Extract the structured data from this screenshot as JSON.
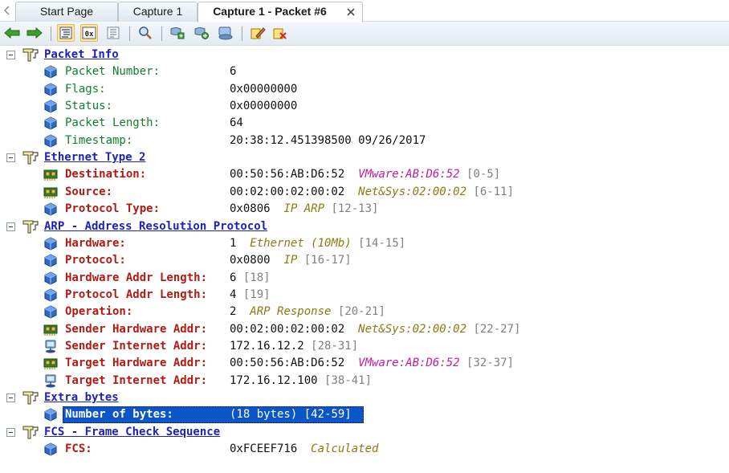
{
  "tabs": [
    {
      "label": "Start Page",
      "active": false
    },
    {
      "label": "Capture 1",
      "active": false
    },
    {
      "label": "Capture 1 - Packet #6",
      "active": true
    }
  ],
  "toolbar": {
    "buttons": [
      "back-arrow-icon",
      "forward-arrow-icon",
      "decode-view-icon",
      "hex-view-icon",
      "text-view-icon",
      "find-icon",
      "add-filter-icon",
      "insert-filter-icon",
      "network-icon",
      "edit-note-icon",
      "clear-note-icon"
    ],
    "hex_label": "0x"
  },
  "colors": {
    "section_title": "#1e22b8",
    "info_label": "#0f7f2e",
    "protocol_label": "#b21a12",
    "description": "#8c7a10",
    "vendor_description": "#c41a9a",
    "byte_range": "#808080",
    "selection": "#0a55c7"
  },
  "sections": [
    {
      "title": "Packet Info",
      "fields": [
        {
          "label": "Packet Number:",
          "style": "info",
          "icon": "cube-icon",
          "value": "6"
        },
        {
          "label": "Flags:",
          "style": "info",
          "icon": "cube-icon",
          "value": "0x00000000"
        },
        {
          "label": "Status:",
          "style": "info",
          "icon": "cube-icon",
          "value": "0x00000000"
        },
        {
          "label": "Packet Length:",
          "style": "info",
          "icon": "cube-icon",
          "value": "64"
        },
        {
          "label": "Timestamp:",
          "style": "info",
          "icon": "cube-icon",
          "value": "20:38:12.451398500 09/26/2017"
        }
      ]
    },
    {
      "title": "Ethernet Type 2",
      "fields": [
        {
          "label": "Destination:",
          "style": "proto",
          "icon": "nic-icon",
          "value": "00:50:56:AB:D6:52",
          "desc": "VMware:AB:D6:52",
          "desc_style": "vendor",
          "range": "[0-5]"
        },
        {
          "label": "Source:",
          "style": "proto",
          "icon": "nic-icon",
          "value": "00:02:00:02:00:02",
          "desc": "Net&Sys:02:00:02",
          "range": "[6-11]"
        },
        {
          "label": "Protocol Type:",
          "style": "proto",
          "icon": "cube-icon",
          "value": "0x0806",
          "desc": "IP ARP",
          "range": "[12-13]"
        }
      ]
    },
    {
      "title": "ARP - Address Resolution Protocol",
      "fields": [
        {
          "label": "Hardware:",
          "style": "proto",
          "icon": "cube-icon",
          "value": "1",
          "desc": "Ethernet (10Mb)",
          "range": "[14-15]"
        },
        {
          "label": "Protocol:",
          "style": "proto",
          "icon": "cube-icon",
          "value": "0x0800",
          "desc": "IP",
          "range": "[16-17]"
        },
        {
          "label": "Hardware Addr Length:",
          "style": "proto",
          "icon": "cube-icon",
          "value": "6",
          "range": "[18]"
        },
        {
          "label": "Protocol Addr Length:",
          "style": "proto",
          "icon": "cube-icon",
          "value": "4",
          "range": "[19]"
        },
        {
          "label": "Operation:",
          "style": "proto",
          "icon": "cube-icon",
          "value": "2",
          "desc": "ARP Response",
          "range": "[20-21]"
        },
        {
          "label": "Sender Hardware Addr:",
          "style": "proto",
          "icon": "nic-icon",
          "value": "00:02:00:02:00:02",
          "desc": "Net&Sys:02:00:02",
          "range": "[22-27]"
        },
        {
          "label": "Sender Internet Addr:",
          "style": "proto",
          "icon": "host-icon",
          "value": "172.16.12.2",
          "range": "[28-31]"
        },
        {
          "label": "Target Hardware Addr:",
          "style": "proto",
          "icon": "nic-icon",
          "value": "00:50:56:AB:D6:52",
          "desc": "VMware:AB:D6:52",
          "desc_style": "vendor",
          "range": "[32-37]"
        },
        {
          "label": "Target Internet Addr:",
          "style": "proto",
          "icon": "host-icon",
          "value": "172.16.12.100",
          "range": "[38-41]"
        }
      ]
    },
    {
      "title": "Extra bytes",
      "fields": [
        {
          "label": "Number of bytes:",
          "style": "proto",
          "icon": "cube-icon",
          "value": "(18 bytes)",
          "range": "[42-59]",
          "selected": true
        }
      ]
    },
    {
      "title": "FCS - Frame Check Sequence",
      "fields": [
        {
          "label": "FCS:",
          "style": "proto",
          "icon": "cube-icon",
          "value": "0xFCEEF716",
          "desc": "Calculated"
        }
      ]
    }
  ]
}
